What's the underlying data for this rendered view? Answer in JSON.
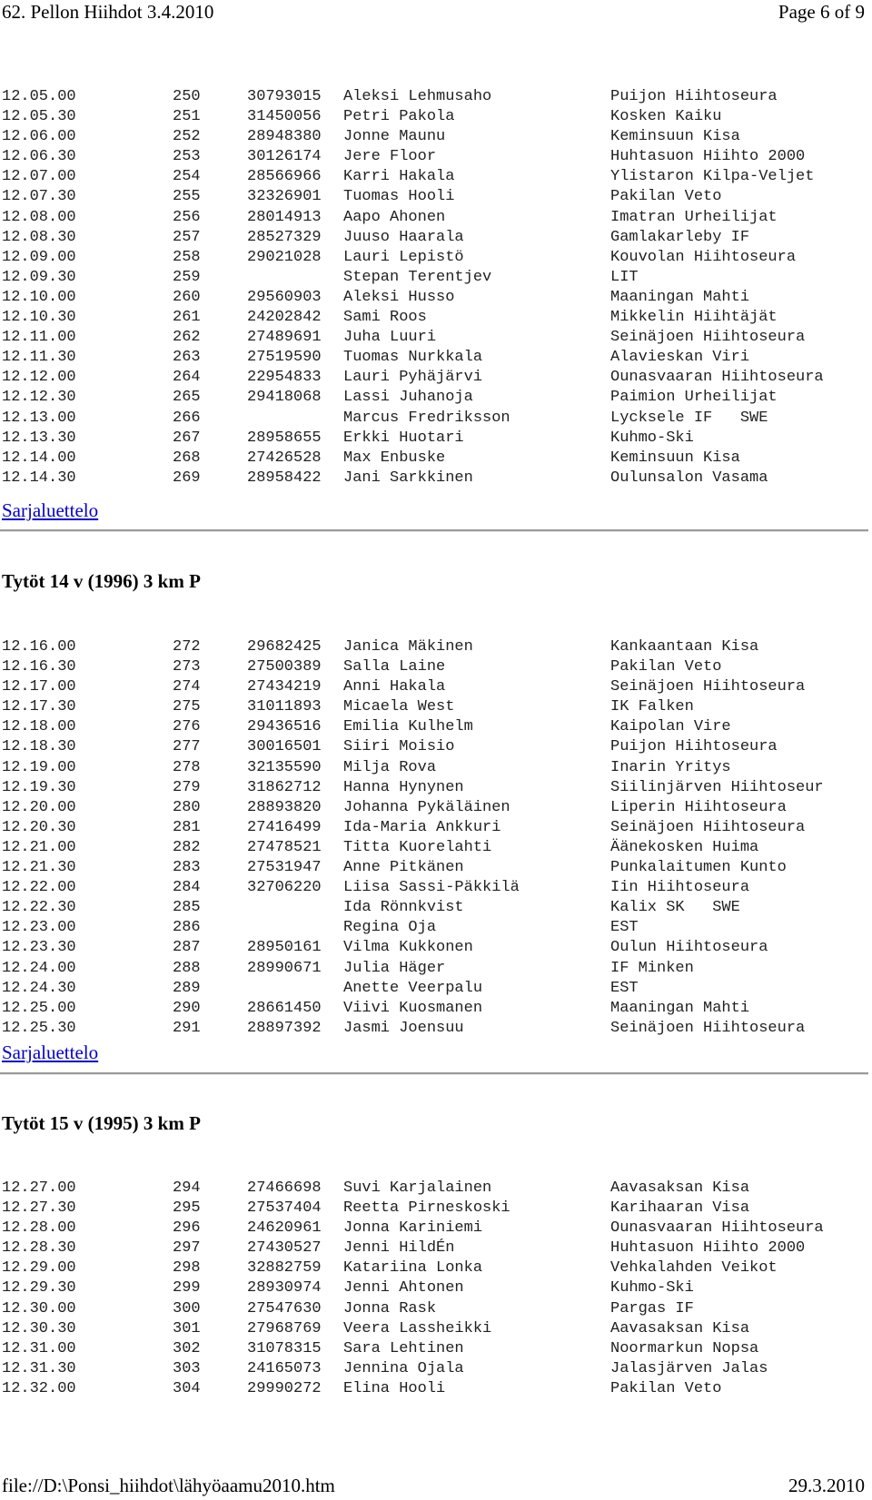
{
  "header": {
    "title": "62. Pellon Hiihdot 3.4.2010",
    "page": "Page 6 of 9"
  },
  "footer": {
    "path": "file://D:\\Ponsi_hiihdot\\lähyöaamu2010.htm",
    "date": "29.3.2010"
  },
  "link_label": "Sarjaluettelo",
  "sections": [
    {
      "heading": "",
      "rows": [
        {
          "time": "12.05.00",
          "num": "250",
          "lic": "30793015",
          "name": "Aleksi Lehmusaho",
          "club": "Puijon Hiihtoseura"
        },
        {
          "time": "12.05.30",
          "num": "251",
          "lic": "31450056",
          "name": "Petri Pakola",
          "club": "Kosken Kaiku"
        },
        {
          "time": "12.06.00",
          "num": "252",
          "lic": "28948380",
          "name": "Jonne Maunu",
          "club": "Keminsuun Kisa"
        },
        {
          "time": "12.06.30",
          "num": "253",
          "lic": "30126174",
          "name": "Jere Floor",
          "club": "Huhtasuon Hiihto 2000"
        },
        {
          "time": "12.07.00",
          "num": "254",
          "lic": "28566966",
          "name": "Karri Hakala",
          "club": "Ylistaron Kilpa-Veljet"
        },
        {
          "time": "12.07.30",
          "num": "255",
          "lic": "32326901",
          "name": "Tuomas Hooli",
          "club": "Pakilan Veto"
        },
        {
          "time": "12.08.00",
          "num": "256",
          "lic": "28014913",
          "name": "Aapo Ahonen",
          "club": "Imatran Urheilijat"
        },
        {
          "time": "12.08.30",
          "num": "257",
          "lic": "28527329",
          "name": "Juuso Haarala",
          "club": "Gamlakarleby IF"
        },
        {
          "time": "12.09.00",
          "num": "258",
          "lic": "29021028",
          "name": "Lauri Lepistö",
          "club": "Kouvolan Hiihtoseura"
        },
        {
          "time": "12.09.30",
          "num": "259",
          "lic": "",
          "name": "Stepan Terentjev",
          "club": "LIT"
        },
        {
          "time": "12.10.00",
          "num": "260",
          "lic": "29560903",
          "name": "Aleksi Husso",
          "club": "Maaningan Mahti"
        },
        {
          "time": "12.10.30",
          "num": "261",
          "lic": "24202842",
          "name": "Sami Roos",
          "club": "Mikkelin Hiihtäjät"
        },
        {
          "time": "12.11.00",
          "num": "262",
          "lic": "27489691",
          "name": "Juha Luuri",
          "club": "Seinäjoen Hiihtoseura"
        },
        {
          "time": "12.11.30",
          "num": "263",
          "lic": "27519590",
          "name": "Tuomas Nurkkala",
          "club": "Alavieskan Viri"
        },
        {
          "time": "12.12.00",
          "num": "264",
          "lic": "22954833",
          "name": "Lauri Pyhäjärvi",
          "club": "Ounasvaaran Hiihtoseura"
        },
        {
          "time": "12.12.30",
          "num": "265",
          "lic": "29418068",
          "name": "Lassi Juhanoja",
          "club": "Paimion Urheilijat"
        },
        {
          "time": "12.13.00",
          "num": "266",
          "lic": "",
          "name": "Marcus Fredriksson",
          "club": "Lycksele IF   SWE"
        },
        {
          "time": "12.13.30",
          "num": "267",
          "lic": "28958655",
          "name": "Erkki Huotari",
          "club": "Kuhmo-Ski"
        },
        {
          "time": "12.14.00",
          "num": "268",
          "lic": "27426528",
          "name": "Max Enbuske",
          "club": "Keminsuun Kisa"
        },
        {
          "time": "12.14.30",
          "num": "269",
          "lic": "28958422",
          "name": "Jani Sarkkinen",
          "club": "Oulunsalon Vasama"
        }
      ]
    },
    {
      "heading": "Tytöt 14 v (1996) 3 km P",
      "rows": [
        {
          "time": "12.16.00",
          "num": "272",
          "lic": "29682425",
          "name": "Janica Mäkinen",
          "club": "Kankaantaan Kisa"
        },
        {
          "time": "12.16.30",
          "num": "273",
          "lic": "27500389",
          "name": "Salla Laine",
          "club": "Pakilan Veto"
        },
        {
          "time": "12.17.00",
          "num": "274",
          "lic": "27434219",
          "name": "Anni Hakala",
          "club": "Seinäjoen Hiihtoseura"
        },
        {
          "time": "12.17.30",
          "num": "275",
          "lic": "31011893",
          "name": "Micaela West",
          "club": "IK Falken"
        },
        {
          "time": "12.18.00",
          "num": "276",
          "lic": "29436516",
          "name": "Emilia Kulhelm",
          "club": "Kaipolan Vire"
        },
        {
          "time": "12.18.30",
          "num": "277",
          "lic": "30016501",
          "name": "Siiri Moisio",
          "club": "Puijon Hiihtoseura"
        },
        {
          "time": "12.19.00",
          "num": "278",
          "lic": "32135590",
          "name": "Milja Rova",
          "club": "Inarin Yritys"
        },
        {
          "time": "12.19.30",
          "num": "279",
          "lic": "31862712",
          "name": "Hanna Hynynen",
          "club": "Siilinjärven Hiihtoseur"
        },
        {
          "time": "12.20.00",
          "num": "280",
          "lic": "28893820",
          "name": "Johanna Pykäläinen",
          "club": "Liperin Hiihtoseura"
        },
        {
          "time": "12.20.30",
          "num": "281",
          "lic": "27416499",
          "name": "Ida-Maria Ankkuri",
          "club": "Seinäjoen Hiihtoseura"
        },
        {
          "time": "12.21.00",
          "num": "282",
          "lic": "27478521",
          "name": "Titta Kuorelahti",
          "club": "Äänekosken Huima"
        },
        {
          "time": "12.21.30",
          "num": "283",
          "lic": "27531947",
          "name": "Anne Pitkänen",
          "club": "Punkalaitumen Kunto"
        },
        {
          "time": "12.22.00",
          "num": "284",
          "lic": "32706220",
          "name": "Liisa Sassi-Päkkilä",
          "club": "Iin Hiihtoseura"
        },
        {
          "time": "12.22.30",
          "num": "285",
          "lic": "",
          "name": "Ida Rönnkvist",
          "club": "Kalix SK   SWE"
        },
        {
          "time": "12.23.00",
          "num": "286",
          "lic": "",
          "name": "Regina Oja",
          "club": "EST"
        },
        {
          "time": "12.23.30",
          "num": "287",
          "lic": "28950161",
          "name": "Vilma Kukkonen",
          "club": "Oulun Hiihtoseura"
        },
        {
          "time": "12.24.00",
          "num": "288",
          "lic": "28990671",
          "name": "Julia Häger",
          "club": "IF Minken"
        },
        {
          "time": "12.24.30",
          "num": "289",
          "lic": "",
          "name": "Anette Veerpalu",
          "club": "EST"
        },
        {
          "time": "12.25.00",
          "num": "290",
          "lic": "28661450",
          "name": "Viivi Kuosmanen",
          "club": "Maaningan Mahti"
        },
        {
          "time": "12.25.30",
          "num": "291",
          "lic": "28897392",
          "name": "Jasmi Joensuu",
          "club": "Seinäjoen Hiihtoseura"
        }
      ]
    },
    {
      "heading": "Tytöt 15 v (1995) 3 km P",
      "rows": [
        {
          "time": "12.27.00",
          "num": "294",
          "lic": "27466698",
          "name": "Suvi Karjalainen",
          "club": "Aavasaksan Kisa"
        },
        {
          "time": "12.27.30",
          "num": "295",
          "lic": "27537404",
          "name": "Reetta Pirneskoski",
          "club": "Karihaaran Visa"
        },
        {
          "time": "12.28.00",
          "num": "296",
          "lic": "24620961",
          "name": "Jonna Kariniemi",
          "club": "Ounasvaaran Hiihtoseura"
        },
        {
          "time": "12.28.30",
          "num": "297",
          "lic": "27430527",
          "name": "Jenni HildÉn",
          "club": "Huhtasuon Hiihto 2000"
        },
        {
          "time": "12.29.00",
          "num": "298",
          "lic": "32882759",
          "name": "Katariina Lonka",
          "club": "Vehkalahden Veikot"
        },
        {
          "time": "12.29.30",
          "num": "299",
          "lic": "28930974",
          "name": "Jenni Ahtonen",
          "club": "Kuhmo-Ski"
        },
        {
          "time": "12.30.00",
          "num": "300",
          "lic": "27547630",
          "name": "Jonna Rask",
          "club": "Pargas IF"
        },
        {
          "time": "12.30.30",
          "num": "301",
          "lic": "27968769",
          "name": "Veera Lassheikki",
          "club": "Aavasaksan Kisa"
        },
        {
          "time": "12.31.00",
          "num": "302",
          "lic": "31078315",
          "name": "Sara Lehtinen",
          "club": "Noormarkun Nopsa"
        },
        {
          "time": "12.31.30",
          "num": "303",
          "lic": "24165073",
          "name": "Jennina Ojala",
          "club": "Jalasjärven Jalas"
        },
        {
          "time": "12.32.00",
          "num": "304",
          "lic": "29990272",
          "name": "Elina Hooli",
          "club": "Pakilan Veto"
        }
      ]
    }
  ]
}
